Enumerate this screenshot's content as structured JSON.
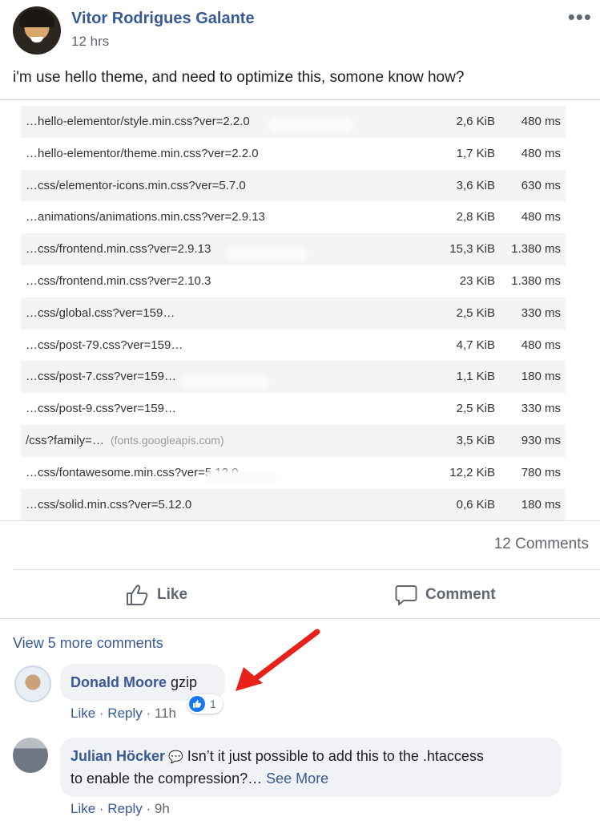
{
  "post": {
    "author": "Vitor Rodrigues Galante",
    "time": "12 hrs",
    "more_icon": "•••",
    "text": "i'm use hello theme, and need to optimize this, somone know how?"
  },
  "requests": [
    {
      "name": "…hello-elementor/style.min.css?ver=2.2.0",
      "host": "",
      "size": "2,6 KiB",
      "time": "480 ms"
    },
    {
      "name": "…hello-elementor/theme.min.css?ver=2.2.0",
      "host": "",
      "size": "1,7 KiB",
      "time": "480 ms"
    },
    {
      "name": "…css/elementor-icons.min.css?ver=5.7.0",
      "host": "",
      "size": "3,6 KiB",
      "time": "630 ms"
    },
    {
      "name": "…animations/animations.min.css?ver=2.9.13",
      "host": "",
      "size": "2,8 KiB",
      "time": "480 ms"
    },
    {
      "name": "…css/frontend.min.css?ver=2.9.13",
      "host": "",
      "size": "15,3 KiB",
      "time": "1.380 ms"
    },
    {
      "name": "…css/frontend.min.css?ver=2.10.3",
      "host": "",
      "size": "23 KiB",
      "time": "1.380 ms"
    },
    {
      "name": "…css/global.css?ver=159…",
      "host": "",
      "size": "2,5 KiB",
      "time": "330 ms"
    },
    {
      "name": "…css/post-79.css?ver=159…",
      "host": "",
      "size": "4,7 KiB",
      "time": "480 ms"
    },
    {
      "name": "…css/post-7.css?ver=159…",
      "host": "",
      "size": "1,1 KiB",
      "time": "180 ms"
    },
    {
      "name": "…css/post-9.css?ver=159…",
      "host": "",
      "size": "2,5 KiB",
      "time": "330 ms"
    },
    {
      "name": "/css?family=…",
      "host": "(fonts.googleapis.com)",
      "size": "3,5 KiB",
      "time": "930 ms"
    },
    {
      "name": "…css/fontawesome.min.css?ver=5.12.0",
      "host": "",
      "size": "12,2 KiB",
      "time": "780 ms"
    },
    {
      "name": "…css/solid.min.css?ver=5.12.0",
      "host": "",
      "size": "0,6 KiB",
      "time": "180 ms"
    }
  ],
  "stats": {
    "comments": "12 Comments"
  },
  "actions": {
    "like": "Like",
    "comment": "Comment"
  },
  "comments_section": {
    "view_more": "View 5 more comments",
    "items": [
      {
        "author": "Donald Moore",
        "text": " gzip",
        "like": "Like",
        "reply": "Reply",
        "time": "11h",
        "reaction_count": "1"
      },
      {
        "author": "Julian Höcker",
        "text_line1": " Isn’t it just possible to add this to the .htaccess",
        "text_line2": "to enable the compression?… ",
        "see_more": "See More",
        "like": "Like",
        "reply": "Reply",
        "time": "9h"
      }
    ]
  },
  "colors": {
    "link": "#385898",
    "muted": "#606770",
    "arrow": "#e8201a",
    "like_badge": "#1877f2"
  }
}
